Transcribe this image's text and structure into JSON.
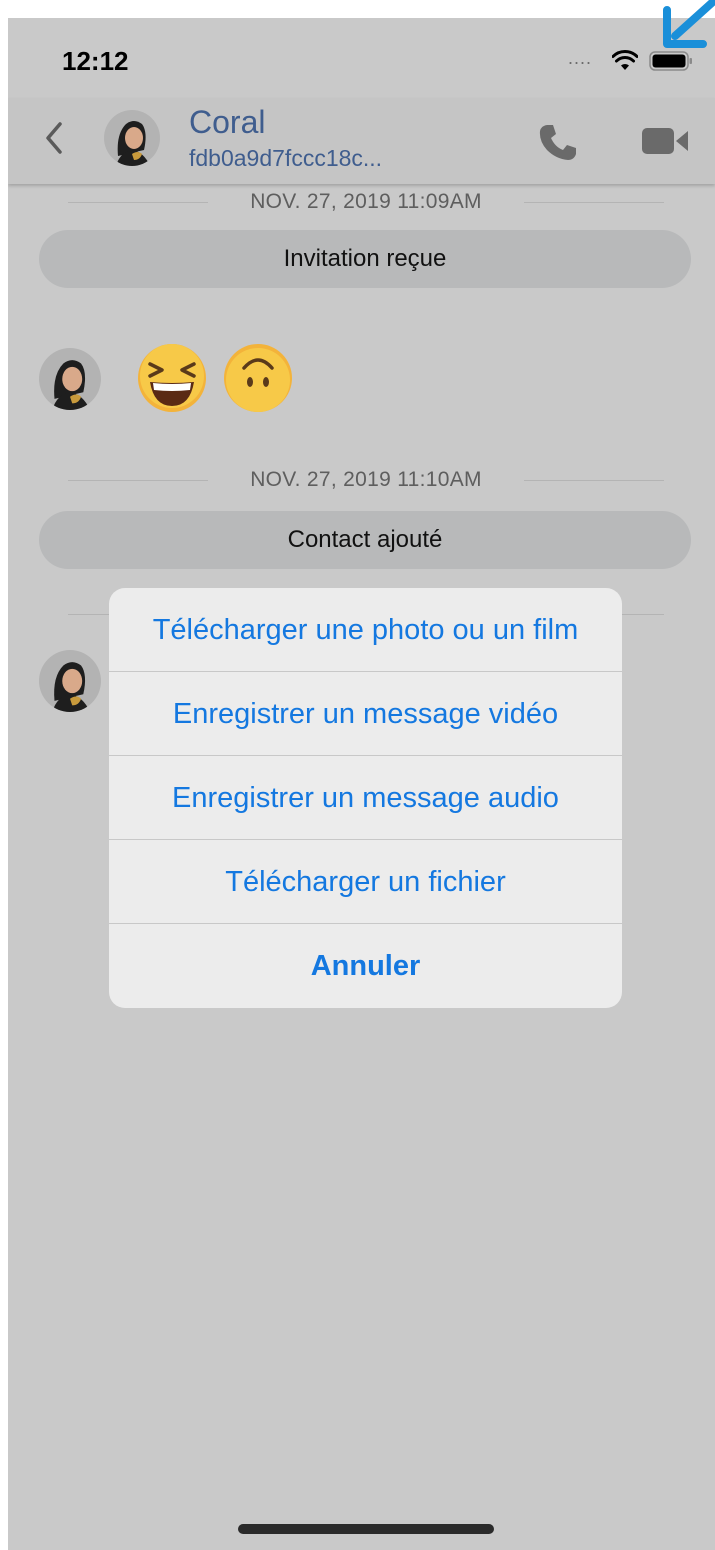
{
  "status_bar": {
    "time": "12:12",
    "signal": "....",
    "icons": [
      "wifi-icon",
      "battery-icon"
    ]
  },
  "header": {
    "contact_name": "Coral",
    "contact_id": "fdb0a9d7fccc18c...",
    "icons": [
      "back-icon",
      "avatar",
      "phone-icon",
      "video-camera-icon"
    ]
  },
  "conversation": {
    "separators": [
      {
        "date": "NOV. 27, 2019 11:09AM"
      },
      {
        "date": "NOV. 27, 2019 11:10AM"
      }
    ],
    "events": [
      {
        "label": "Invitation reçue"
      },
      {
        "label": "Contact ajouté"
      }
    ],
    "emoji_message": [
      "laughing-squinting-face",
      "upside-down-face"
    ]
  },
  "action_sheet": {
    "items": [
      {
        "label": "Télécharger une photo ou un film"
      },
      {
        "label": "Enregistrer un message vidéo"
      },
      {
        "label": "Enregistrer un message audio"
      },
      {
        "label": "Télécharger un fichier"
      }
    ],
    "cancel_label": "Annuler"
  },
  "colors": {
    "accent": "#1478e0",
    "header_text": "#3f5d8e",
    "overlay_background": "#c9c9c9",
    "annotation_arrow": "#1a8fd9"
  }
}
